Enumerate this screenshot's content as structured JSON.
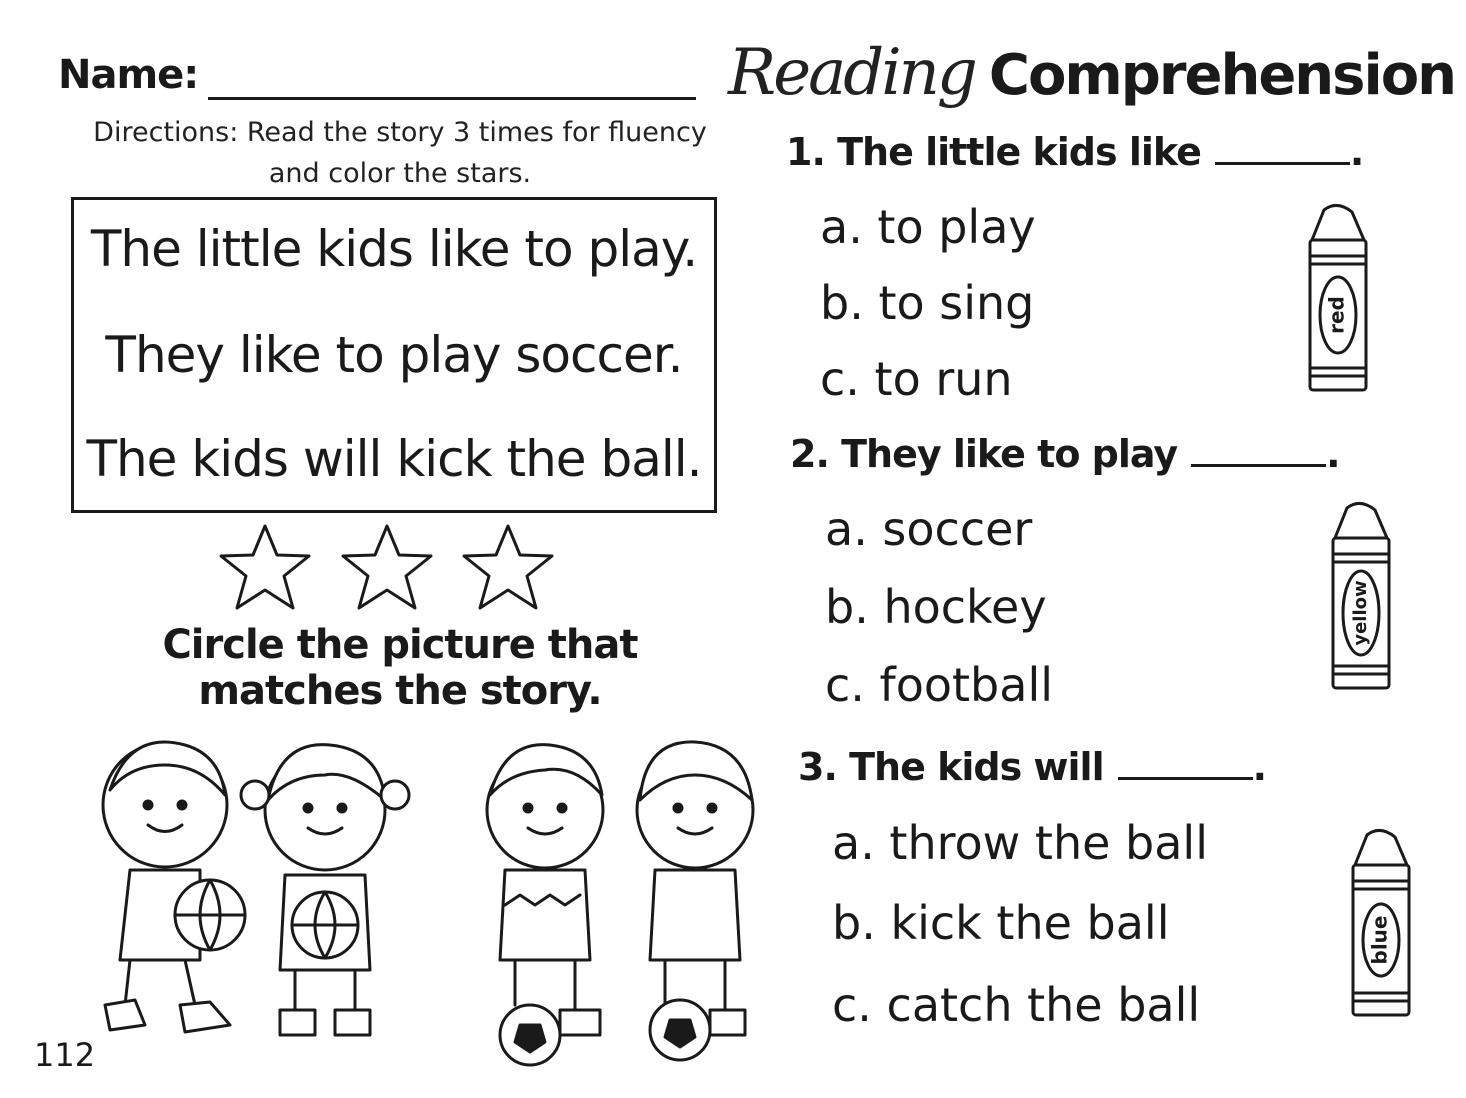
{
  "header": {
    "name_label": "Name:",
    "title_script": "Reading",
    "title_bold": "Comprehension"
  },
  "directions": {
    "line1": "Directions: Read the story 3 times for fluency",
    "line2": "and color the stars."
  },
  "story": {
    "lines": [
      "The little kids like to play.",
      "They like to play soccer.",
      "The kids will kick the ball."
    ]
  },
  "stars": {
    "count": 3
  },
  "activity": {
    "line1": "Circle the picture that",
    "line2": "matches the story."
  },
  "questions": [
    {
      "prompt": "1. The little kids like",
      "end": ".",
      "options": [
        "a. to play",
        "b. to sing",
        "c. to run"
      ],
      "crayon_label": "red"
    },
    {
      "prompt": "2. They like to play",
      "end": ".",
      "options": [
        "a. soccer",
        "b. hockey",
        "c. football"
      ],
      "crayon_label": "yellow"
    },
    {
      "prompt": "3. The kids will",
      "end": ".",
      "options": [
        "a. throw the ball",
        "b. kick the ball",
        "c. catch the ball"
      ],
      "crayon_label": "blue"
    }
  ],
  "page_number": "112",
  "icons": [
    "star-outline-icon",
    "crayon-icon",
    "kids-basketball-illustration",
    "kids-soccer-illustration"
  ]
}
